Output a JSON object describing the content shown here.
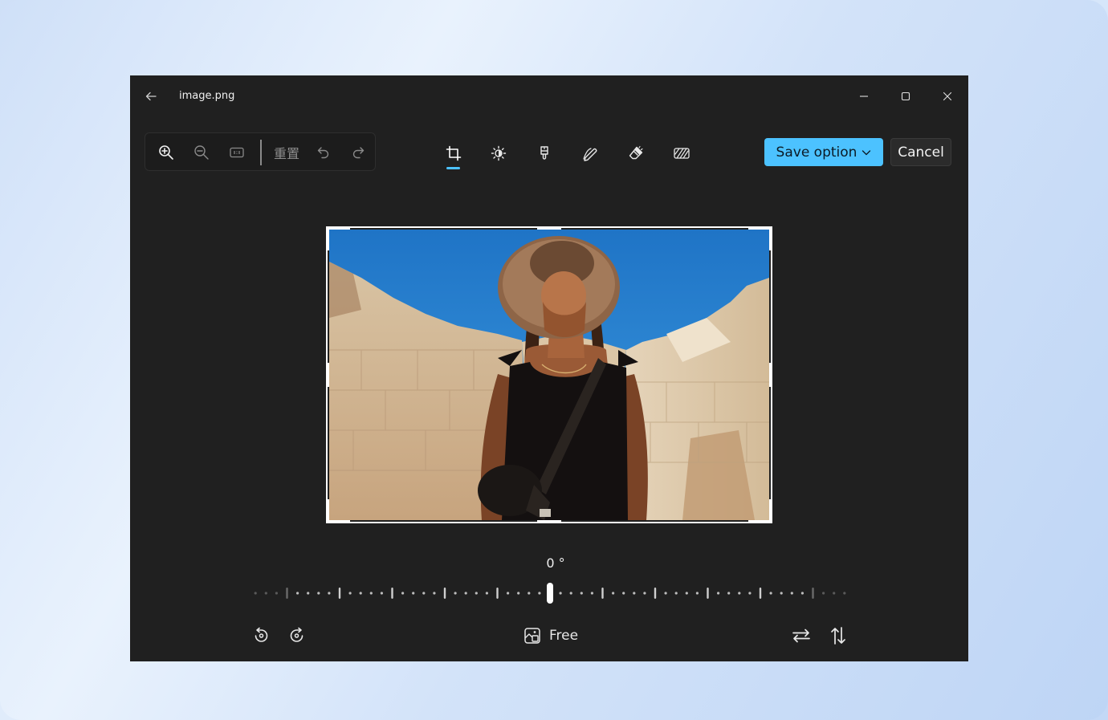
{
  "window": {
    "title": "image.png"
  },
  "toolbar_left": {
    "reset_label": "重置"
  },
  "tools": [
    {
      "name": "crop",
      "active": true
    },
    {
      "name": "adjust"
    },
    {
      "name": "filter"
    },
    {
      "name": "markup"
    },
    {
      "name": "erase"
    },
    {
      "name": "blur"
    }
  ],
  "actions": {
    "save_label": "Save option",
    "cancel_label": "Cancel"
  },
  "rotation": {
    "angle_label": "0 °",
    "value": 0
  },
  "aspect_ratio": {
    "label": "Free"
  },
  "colors": {
    "window_bg": "#202020",
    "accent": "#4cc2ff"
  }
}
